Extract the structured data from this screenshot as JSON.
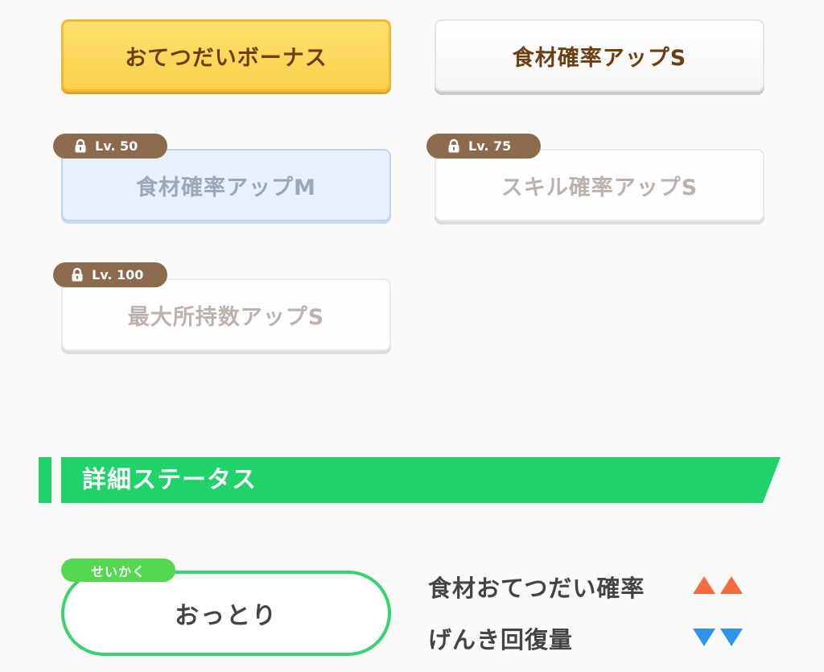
{
  "main_skills": [
    {
      "label": "おてつだいボーナス",
      "style": "gold",
      "locked": false
    },
    {
      "label": "食材確率アップS",
      "style": "white",
      "locked": false
    },
    {
      "label": "食材確率アップM",
      "style": "blue",
      "locked": true,
      "level": "Lv. 50"
    },
    {
      "label": "スキル確率アップS",
      "style": "white",
      "locked": true,
      "level": "Lv. 75"
    },
    {
      "label": "最大所持数アップS",
      "style": "white",
      "locked": true,
      "level": "Lv. 100"
    }
  ],
  "details": {
    "title": "詳細ステータス",
    "nature_tag": "せいかく",
    "nature_value": "おっとり",
    "effects": [
      {
        "label": "食材おてつだい確率",
        "direction": "up",
        "color": "#f36b3f",
        "icon": "up-triangle-icon"
      },
      {
        "label": "げんき回復量",
        "direction": "down",
        "color": "#2f95ec",
        "icon": "down-triangle-icon"
      }
    ]
  },
  "colors": {
    "accent_green": "#1fd36a",
    "lock_badge": "#8c6a4e",
    "gold": "#fad24a"
  }
}
